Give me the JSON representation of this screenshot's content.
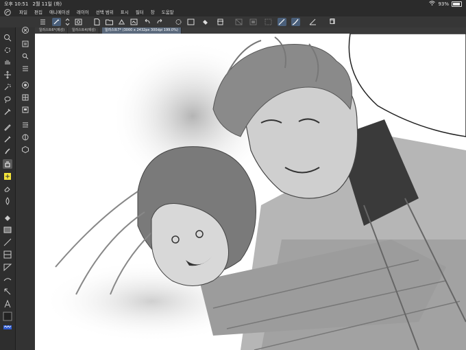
{
  "status_bar": {
    "time": "오후 10:51",
    "date": "2월 11일 (화)",
    "battery_percent": "93%",
    "battery_level": 0.93
  },
  "menu": {
    "items": [
      "파일",
      "편집",
      "애니메이션",
      "레이어",
      "선택 범위",
      "표시",
      "필터",
      "창",
      "도움말"
    ]
  },
  "tabs": [
    {
      "label": "일러스트6*(제성)",
      "active": false
    },
    {
      "label": "일러스트4(제성)",
      "active": false
    },
    {
      "label": "일러스트7* (3000 x 2432px 300dpi 199.0%)",
      "active": true
    }
  ],
  "toolbar_icons": [
    "menu-icon",
    "pen-pressure-icon",
    "swap-icon",
    "new-canvas-icon",
    "open-icon",
    "save-icon",
    "undo-icon",
    "redo-icon",
    "spinner-icon",
    "clear-icon",
    "fill-icon",
    "transform-icon",
    "select-off-icon",
    "select-invert-icon",
    "stabilizer-icon",
    "pen-curve-icon",
    "ruler-icon",
    "snap-icon"
  ],
  "colors": {
    "accent": "#4a5f7a",
    "selected_color_chip": "#f3e43a",
    "main_color": "#222222"
  },
  "artwork": {
    "subject": "grayscale sketch of two characters"
  }
}
